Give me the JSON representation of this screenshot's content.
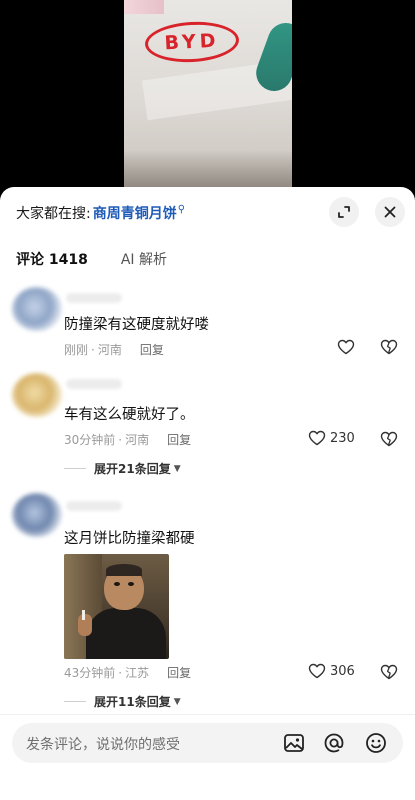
{
  "video": {
    "logo_text": "BYD"
  },
  "header": {
    "search_prefix": "大家都在搜:",
    "search_term": "商周青铜月饼",
    "search_glyph": "⚲"
  },
  "tabs": [
    {
      "label": "评论 1418",
      "active": true
    },
    {
      "label": "AI 解析",
      "active": false
    }
  ],
  "comments": [
    {
      "text": "防撞梁有这硬度就好喽",
      "time": "刚刚",
      "separator": "·",
      "location": "河南",
      "reply_label": "回复",
      "likes": "",
      "avatar_color": "#9fb4d3"
    },
    {
      "text": "车有这么硬就好了。",
      "time": "30分钟前",
      "separator": "·",
      "location": "河南",
      "reply_label": "回复",
      "likes": "230",
      "expand_label": "展开21条回复",
      "avatar_color": "#e3c47e"
    },
    {
      "text": "这月饼比防撞梁都硬",
      "time": "43分钟前",
      "separator": "·",
      "location": "江苏",
      "reply_label": "回复",
      "likes": "306",
      "expand_label": "展开11条回复",
      "avatar_color": "#8ea6c8"
    }
  ],
  "composer": {
    "placeholder": "发条评论，说说你的感受"
  },
  "icons": [
    "expand-icon",
    "close-icon",
    "heart-icon",
    "dislike-heart-icon",
    "chevron-down-icon",
    "image-icon",
    "at-icon",
    "emoji-icon"
  ],
  "colors": {
    "accent_blue": "#1f5bb8",
    "byd_red": "#d8232a"
  }
}
